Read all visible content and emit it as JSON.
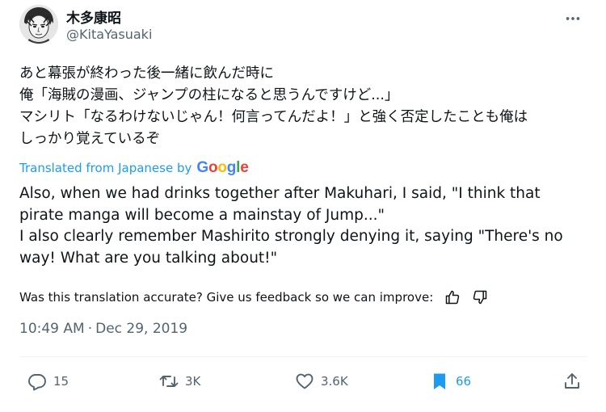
{
  "author": {
    "display_name": "木多康昭",
    "handle": "@KitaYasuaki"
  },
  "original_lines": [
    "あと幕張が終わった後一緒に飲んだ時に",
    "俺「海賊の漫画、ジャンプの柱になると思うんですけど...」",
    "マシリト「なるわけないじゃん！何言ってんだよ！」と強く否定したことも俺は",
    "しっかり覚えているぞ"
  ],
  "translated_by": {
    "label": "Translated from Japanese by",
    "google_letters": [
      "G",
      "o",
      "o",
      "g",
      "l",
      "e"
    ]
  },
  "translation_lines": [
    "Also, when we had drinks together after Makuhari, I said, \"I think that",
    "pirate manga will become a mainstay of Jump...\"",
    "I also clearly remember Mashirito strongly denying it, saying \"There's no",
    "way! What are you talking about!\""
  ],
  "feedback": {
    "prompt": "Was this translation accurate? Give us feedback so we can improve:",
    "thumbs_up_icon": "thumbs-up-icon",
    "thumbs_down_icon": "thumbs-down-icon"
  },
  "timestamp": {
    "time": "10:49 AM",
    "separator": "·",
    "date": "Dec 29, 2019"
  },
  "actions": {
    "replies": "15",
    "reposts": "3K",
    "likes": "3.6K",
    "bookmarks": "66"
  },
  "colors": {
    "accent": "#1d9bf0",
    "text": "#0f1419",
    "secondary": "#536471"
  }
}
